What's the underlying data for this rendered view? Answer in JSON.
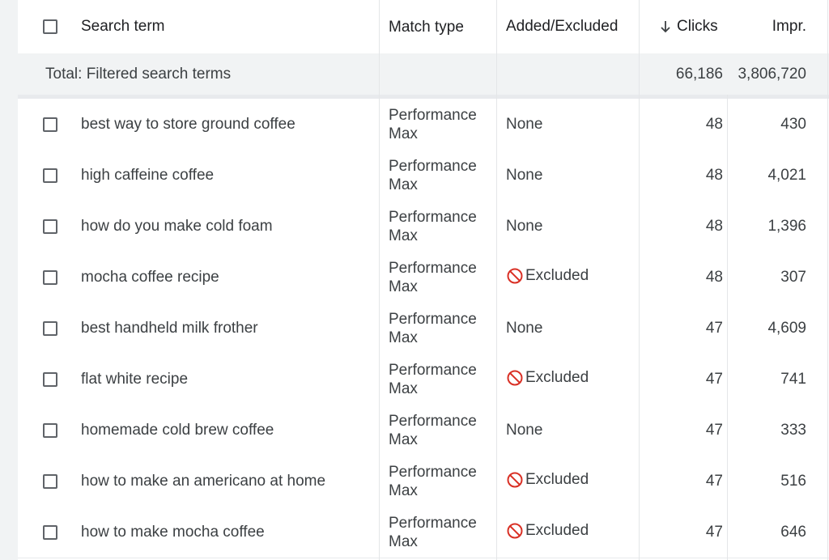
{
  "header": {
    "search_term": "Search term",
    "match_type": "Match type",
    "added_excluded": "Added/Excluded",
    "clicks": "Clicks",
    "impr": "Impr."
  },
  "total": {
    "label": "Total: Filtered search terms",
    "clicks": "66,186",
    "impr": "3,806,720"
  },
  "rows": [
    {
      "term": "best way to store ground coffee",
      "match_line1": "Performance",
      "match_line2": "Max",
      "status": "None",
      "clicks": "48",
      "impr": "430"
    },
    {
      "term": "high caffeine coffee",
      "match_line1": "Performance",
      "match_line2": "Max",
      "status": "None",
      "clicks": "48",
      "impr": "4,021"
    },
    {
      "term": "how do you make cold foam",
      "match_line1": "Performance",
      "match_line2": "Max",
      "status": "None",
      "clicks": "48",
      "impr": "1,396"
    },
    {
      "term": "mocha coffee recipe",
      "match_line1": "Performance",
      "match_line2": "Max",
      "status": "Excluded",
      "clicks": "48",
      "impr": "307"
    },
    {
      "term": "best handheld milk frother",
      "match_line1": "Performance",
      "match_line2": "Max",
      "status": "None",
      "clicks": "47",
      "impr": "4,609"
    },
    {
      "term": "flat white recipe",
      "match_line1": "Performance",
      "match_line2": "Max",
      "status": "Excluded",
      "clicks": "47",
      "impr": "741"
    },
    {
      "term": "homemade cold brew coffee",
      "match_line1": "Performance",
      "match_line2": "Max",
      "status": "None",
      "clicks": "47",
      "impr": "333"
    },
    {
      "term": "how to make an americano at home",
      "match_line1": "Performance",
      "match_line2": "Max",
      "status": "Excluded",
      "clicks": "47",
      "impr": "516"
    },
    {
      "term": "how to make mocha coffee",
      "match_line1": "Performance",
      "match_line2": "Max",
      "status": "Excluded",
      "clicks": "47",
      "impr": "646"
    }
  ],
  "colors": {
    "excluded_icon": "#d93025",
    "text": "#3c4043",
    "total_bg": "#f1f3f4"
  },
  "icons": {
    "sort": "arrow-down-icon",
    "excluded": "block-icon"
  }
}
